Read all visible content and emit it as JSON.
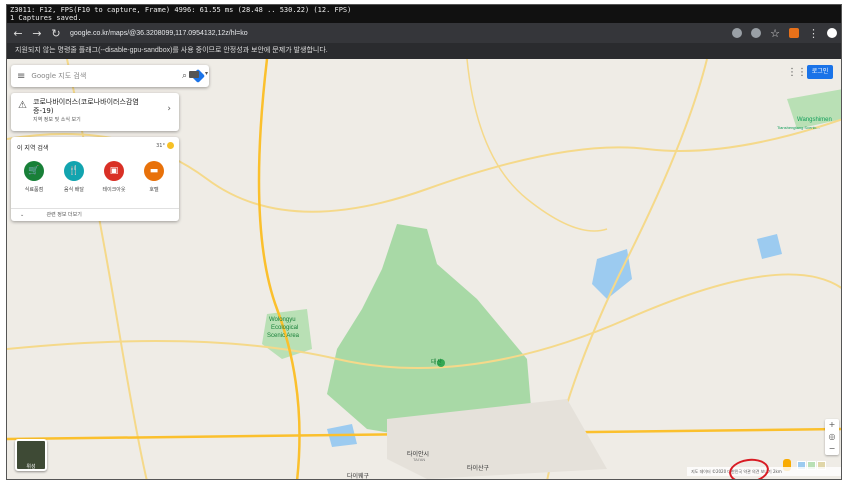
{
  "overlay": {
    "line1": "Z3011: F12, FPS(F10 to capture, Frame) 4996: 61.55 ms (28.48 .. 530.22) (12. FPS)",
    "line2": "1 Captures saved."
  },
  "browser": {
    "url": "google.co.kr/maps/@36.3208099,117.0954132,12z/hl=ko",
    "infobar": "지원되지 않는 명령줄 플래그(--disable-gpu-sandbox)를 사용 중이므로 안정성과 보안에 문제가 발생합니다."
  },
  "search": {
    "placeholder": "Google 지도 검색"
  },
  "covid": {
    "title": "코로나바이러스(코로나바이러스감염",
    "title2": "증-19)",
    "sub": "지역 정보 및 소식 보기"
  },
  "explore": {
    "title": "이 지역 검색",
    "temp": "31°",
    "categories": [
      {
        "label": "식료품점",
        "icon": "cart-icon",
        "color": "#188038"
      },
      {
        "label": "음식 배달",
        "icon": "delivery-icon",
        "color": "#12a4af"
      },
      {
        "label": "테이크아웃",
        "icon": "takeout-icon",
        "color": "#d93025"
      },
      {
        "label": "호텔",
        "icon": "hotel-icon",
        "color": "#e8710a"
      }
    ],
    "more": "관련 정보 더보기"
  },
  "header": {
    "login": "로그인"
  },
  "map": {
    "labels": {
      "wangshimen": "Wangshimen",
      "wangshimen_sub": "Tianshengtang Scenic...",
      "wolongyu1": "Wolongyu",
      "wolongyu2": "Ecological",
      "wolongyu3": "Scenic Area",
      "taishan": "태산",
      "taian": "타이안시",
      "taian_en": "TAI'AN",
      "daiyue": "다이웨구",
      "taishan_dist": "타이산구"
    },
    "satellite_label": "위성",
    "footer": "지도 데이터 ©2020   대한민국   약관   의견 보내기   2km"
  }
}
